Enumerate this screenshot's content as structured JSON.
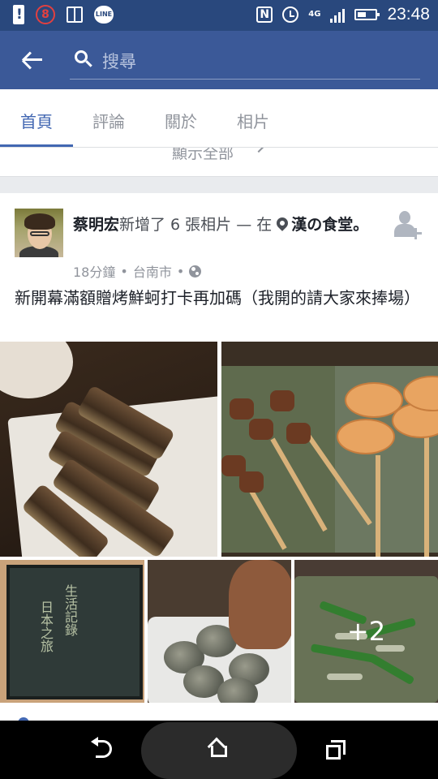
{
  "status_bar": {
    "notification_count": "8",
    "line_label": "LINE",
    "nfc_label": "N",
    "network_label": "4G",
    "battery_level": 0.5,
    "time": "23:48"
  },
  "header": {
    "search_placeholder": "搜尋"
  },
  "tabs": [
    {
      "label": "首頁",
      "active": true
    },
    {
      "label": "評論",
      "active": false
    },
    {
      "label": "關於",
      "active": false
    },
    {
      "label": "相片",
      "active": false
    }
  ],
  "show_all_label": "顯示全部",
  "post": {
    "author": "蔡明宏",
    "action": "新增了 6 張相片 — 在",
    "place": "漢の食堂",
    "place_suffix": "。",
    "time_ago": "18分鐘",
    "location": "台南市",
    "separator": "•",
    "text": "新開幕滿額贈烤鮮蚵打卡再加碼（我開的請大家來捧場）",
    "more_photos_label": "+2"
  },
  "colors": {
    "facebook_blue": "#3b5998",
    "status_bar": "#29487d",
    "active_tab": "#4267b2",
    "secondary_text": "#90949c"
  },
  "icons": [
    "back-arrow-icon",
    "search-icon",
    "location-pin-icon",
    "add-friend-icon",
    "globe-icon",
    "nav-back-icon",
    "nav-home-icon",
    "nav-recent-apps-icon"
  ]
}
